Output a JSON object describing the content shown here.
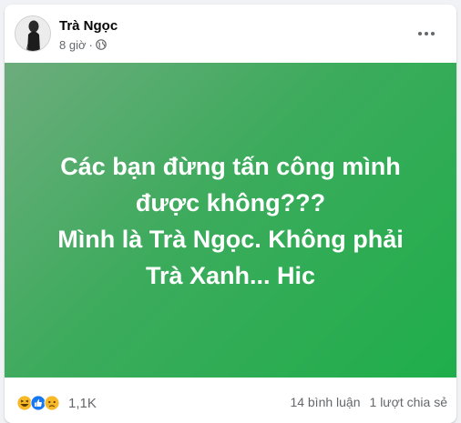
{
  "post": {
    "author": "Trà Ngọc",
    "time": "8 giờ",
    "separator": "·",
    "privacy_icon": "globe-icon",
    "more_icon": "more-dots-icon"
  },
  "banner": {
    "lines": [
      "Các bạn đừng tấn công mình",
      "được không???",
      "Mình là Trà Ngọc. Không phải",
      "Trà Xanh... Hic"
    ],
    "gradient_start": "#6dac7d",
    "gradient_end": "#1fae4b",
    "text_color": "#ffffff"
  },
  "footer": {
    "reactions": [
      "haha-icon",
      "like-icon",
      "sad-icon"
    ],
    "reaction_count": "1,1K",
    "comments": "14 bình luận",
    "shares": "1 lượt chia sẻ"
  },
  "colors": {
    "like_blue": "#1877f2",
    "emoji_yellow": "#f7b928",
    "secondary_text": "#65676b"
  }
}
